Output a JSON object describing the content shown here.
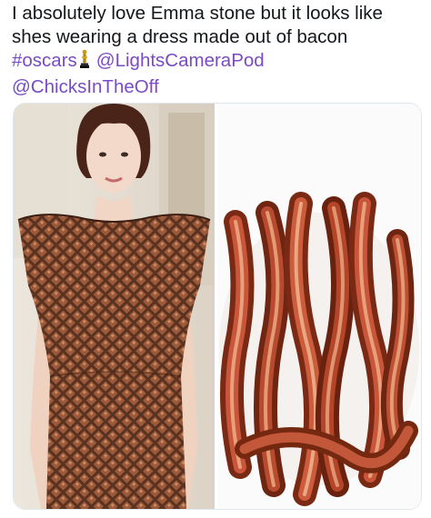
{
  "tweet": {
    "text_line1": "I absolutely love Emma stone but it looks like",
    "text_line2": "shes wearing a dress made out of bacon",
    "hashtag": "#oscars",
    "mention1": "@LightsCameraPod",
    "mention2": "@ChicksInTheOff"
  },
  "media": {
    "left_photo": "emma-stone-dress-photo",
    "right_photo": "bacon-strips-photo"
  },
  "colors": {
    "link": "#794bc4",
    "text": "#14171a",
    "border": "#e1e8ed"
  },
  "icons": {
    "oscar": "oscar-trophy-icon"
  }
}
